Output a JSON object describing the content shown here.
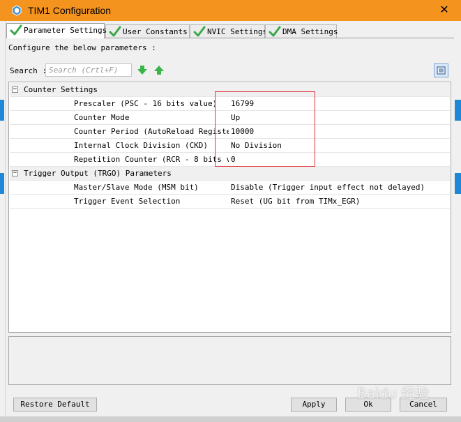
{
  "window": {
    "title": "TIM1 Configuration",
    "close_symbol": "✕"
  },
  "tabs": [
    {
      "label": "Parameter Settings",
      "active": true
    },
    {
      "label": "User Constants",
      "active": false
    },
    {
      "label": "NVIC Settings",
      "active": false
    },
    {
      "label": "DMA Settings",
      "active": false
    }
  ],
  "description": "Configure the below parameters :",
  "search": {
    "label": "Search :",
    "placeholder": "Search (Crtl+F)"
  },
  "groups": {
    "counter": {
      "title": "Counter Settings",
      "toggle": "⊟",
      "params": [
        {
          "name": "Prescaler (PSC - 16 bits value)",
          "value": "16799"
        },
        {
          "name": "Counter Mode",
          "value": "Up"
        },
        {
          "name": "Counter Period (AutoReload Registe...",
          "value": "10000"
        },
        {
          "name": "Internal Clock Division (CKD)",
          "value": "No Division"
        },
        {
          "name": "Repetition Counter (RCR - 8 bits v...",
          "value": "0"
        }
      ]
    },
    "trigger": {
      "title": "Trigger Output (TRGO) Parameters",
      "toggle": "⊟",
      "params": [
        {
          "name": "Master/Slave Mode (MSM bit)",
          "value": "Disable (Trigger input effect not delayed)"
        },
        {
          "name": "Trigger Event Selection",
          "value": "Reset (UG bit from TIMx_EGR)"
        }
      ]
    }
  },
  "buttons": {
    "restore": "Restore Default",
    "apply": "Apply",
    "ok": "Ok",
    "cancel": "Cancel"
  },
  "watermark": "Baidu 经验",
  "colors": {
    "titlebar": "#f5931f",
    "check": "#3aa84a",
    "arrow": "#3bb54a",
    "highlight": "#e0313a"
  }
}
